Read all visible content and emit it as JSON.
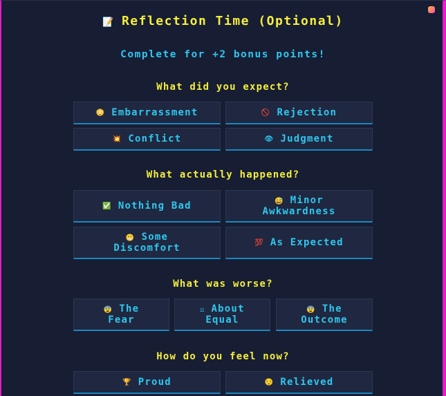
{
  "header": {
    "title_icon": "memo-icon",
    "title_emoji": "📝",
    "title": "Reflection Time (Optional)",
    "subtitle": "Complete for +2 bonus points!"
  },
  "sections": {
    "expect": {
      "question": "What did you expect?",
      "options": [
        {
          "emoji": "😳",
          "icon": "flushed-face-icon",
          "label": "Embarrassment"
        },
        {
          "emoji": "🚫",
          "icon": "no-entry-icon",
          "label": "Rejection"
        },
        {
          "emoji": "💥",
          "icon": "collision-icon",
          "label": "Conflict"
        },
        {
          "emoji": "👁",
          "icon": "eye-icon",
          "label": "Judgment"
        }
      ]
    },
    "happened": {
      "question": "What actually happened?",
      "options": [
        {
          "emoji": "✅",
          "icon": "check-mark-icon",
          "label": "Nothing Bad"
        },
        {
          "emoji": "😅",
          "icon": "sweat-smile-icon",
          "label_line1": "Minor",
          "label_line2": "Awkwardness"
        },
        {
          "emoji": "😬",
          "icon": "grimace-icon",
          "label_line1": "Some",
          "label_line2": "Discomfort"
        },
        {
          "emoji": "💯",
          "icon": "hundred-icon",
          "label": "As Expected"
        }
      ]
    },
    "worse": {
      "question": "What was worse?",
      "options": [
        {
          "emoji": "😨",
          "icon": "fearful-face-icon",
          "label_line1": "The",
          "label_line2": "Fear"
        },
        {
          "emoji": "⚖",
          "icon": "scales-icon",
          "label_line1": "About",
          "label_line2": "Equal"
        },
        {
          "emoji": "😨",
          "icon": "fearful-face-icon",
          "label_line1": "The",
          "label_line2": "Outcome"
        }
      ]
    },
    "feel": {
      "question": "How do you feel now?",
      "options": [
        {
          "emoji": "🏆",
          "icon": "trophy-icon",
          "label": "Proud"
        },
        {
          "emoji": "😌",
          "icon": "relieved-face-icon",
          "label": "Relieved"
        }
      ]
    }
  }
}
